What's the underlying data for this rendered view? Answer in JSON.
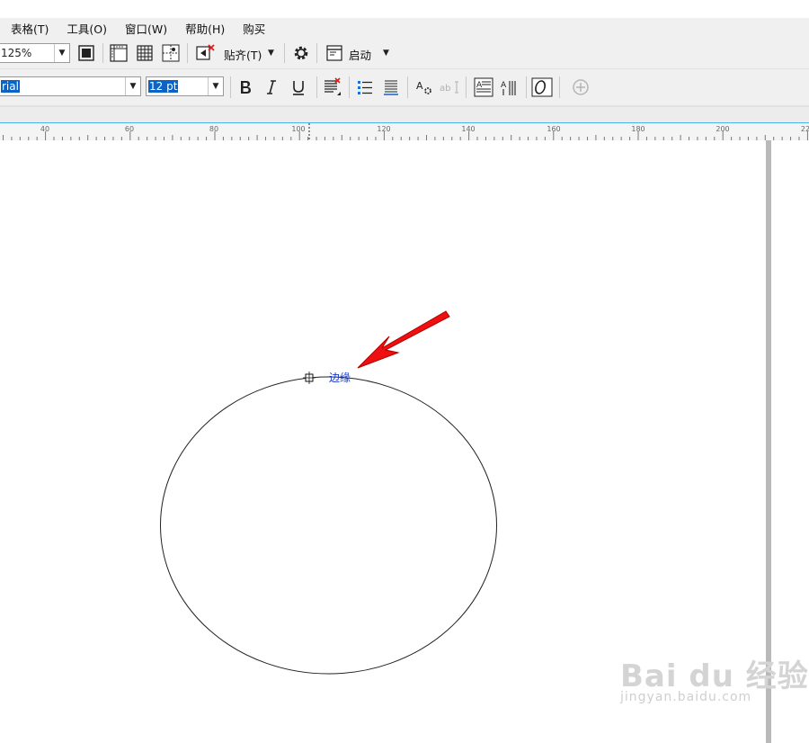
{
  "menu": {
    "items": [
      "表格(T)",
      "工具(O)",
      "窗口(W)",
      "帮助(H)",
      "购买"
    ]
  },
  "toolbar1": {
    "zoom_value": "125%",
    "snap_label": "贴齐(T)",
    "launch_label": "启动"
  },
  "toolbar2": {
    "font_value": "rial",
    "size_value": "12 pt"
  },
  "ruler": {
    "labels": [
      "40",
      "60",
      "80",
      "100",
      "120",
      "140",
      "160",
      "180",
      "200",
      "22"
    ]
  },
  "canvas": {
    "path_text": "边缘"
  },
  "watermark": {
    "main": "Bai du 经验",
    "sub": "jingyan.baidu.com"
  },
  "colors": {
    "accent": "#0a64c8",
    "path_text": "#1a3cc8",
    "arrow": "#ee1010",
    "ruler_border": "#49b6e6"
  }
}
